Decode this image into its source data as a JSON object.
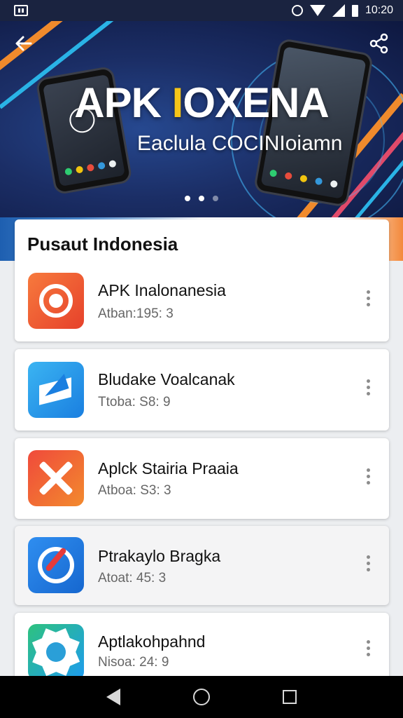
{
  "status_bar": {
    "time": "10:20",
    "icons": [
      "notification-icon",
      "alarm-icon",
      "wifi-icon",
      "signal-icon",
      "battery-icon"
    ]
  },
  "banner": {
    "title_main": "APK ",
    "title_accent": "I",
    "title_rest": "OXENA",
    "subtitle": "Eaclula COCINIoiamn",
    "carousel_dots": 3,
    "active_dot": 1,
    "colors": {
      "accent": "#f5c518",
      "stripe_orange": "#f08a2c",
      "stripe_blue": "#2ab3e6"
    }
  },
  "section": {
    "title": "Pusaut Indonesia"
  },
  "apps": [
    {
      "name": "APK Inalonanesia",
      "meta": "Atban:195: 3",
      "icon": "target-icon"
    },
    {
      "name": "Bludake Voalcanak",
      "meta": "Ttoba: S8: 9",
      "icon": "paper-plane-icon"
    },
    {
      "name": "Aplck Stairia Praaia",
      "meta": "Atboa: S3: 3",
      "icon": "cross-icon"
    },
    {
      "name": "Ptrakaylo Bragka",
      "meta": "Atoat: 45: 3",
      "icon": "compass-icon"
    },
    {
      "name": "Aptlakohpahnd",
      "meta": "Nisoa: 24: 9",
      "icon": "gear-icon"
    }
  ],
  "nav_bar": {
    "icons": [
      "back-triangle-icon",
      "home-circle-icon",
      "recents-square-icon"
    ]
  }
}
